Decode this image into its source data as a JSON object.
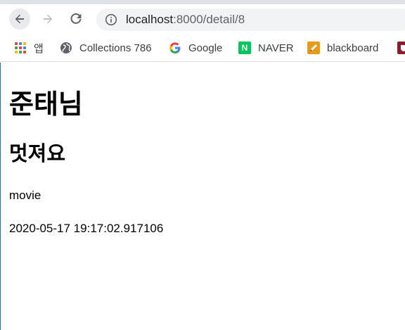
{
  "browser": {
    "url_host": "localhost",
    "url_path": ":8000/detail/8"
  },
  "bookmarks": [
    {
      "label": "앱",
      "icon": "apps-grid-icon"
    },
    {
      "label": "Collections 786",
      "icon": "globe-icon"
    },
    {
      "label": "Google",
      "icon": "google-g-icon"
    },
    {
      "label": "NAVER",
      "icon": "naver-n-icon",
      "icon_text": "N"
    },
    {
      "label": "blackboard",
      "icon": "blackboard-pencil-icon"
    }
  ],
  "page": {
    "title": "준태님",
    "subtitle": "멋져요",
    "category": "movie",
    "timestamp": "2020-05-17 19:17:02.917106"
  },
  "colors": {
    "naver_green": "#03c75a",
    "blackboard_orange": "#e89a1c",
    "omnibox_bg": "#f1f3f4"
  }
}
